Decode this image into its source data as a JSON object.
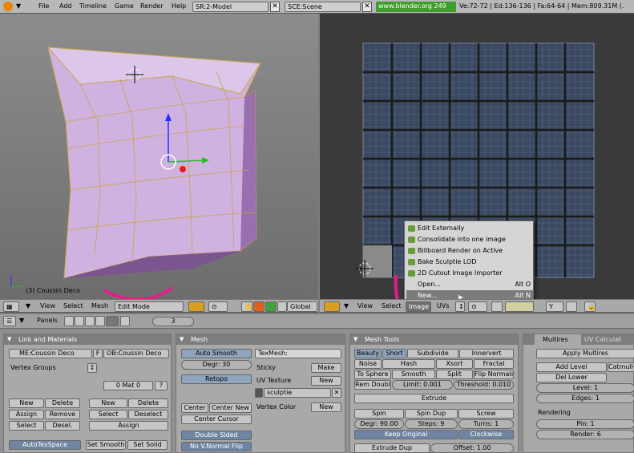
{
  "topbar": {
    "menu": [
      "File",
      "Add",
      "Timeline",
      "Game",
      "Render",
      "Help"
    ],
    "screen": "SR:2-Model",
    "scene": "SCE:Scene",
    "link": "www.blender.org 249",
    "stats": "Ve:72-72 | Ed:136-136 | Fa:64-64 | Mem:809.31M (."
  },
  "viewport": {
    "object_label": "(3) Coussin Deco",
    "menus": [
      "View",
      "Select",
      "Mesh"
    ],
    "mode": "Edit Mode",
    "orientation": "Global"
  },
  "uv_editor": {
    "menus": [
      "View",
      "Select",
      "Image",
      "UVs"
    ],
    "context_menu": {
      "items": [
        {
          "label": "Edit Externally",
          "shortcut": ""
        },
        {
          "label": "Consolidate into one image",
          "shortcut": ""
        },
        {
          "label": "Billboard Render on Active",
          "shortcut": ""
        },
        {
          "label": "Bake Sculptie LOD",
          "shortcut": ""
        },
        {
          "label": "2D Cutout Image Importer",
          "shortcut": ""
        },
        {
          "label": "Open...",
          "shortcut": "Alt O"
        },
        {
          "label": "New...",
          "shortcut": "Alt N"
        }
      ]
    }
  },
  "panels_bar": {
    "label": "Panels",
    "page": "3"
  },
  "link_materials": {
    "title": "Link and Materials",
    "mesh_name": "ME:Coussin Deco",
    "f_label": "F",
    "ob_name": "OB:Coussin Deco",
    "vertex_groups": "Vertex Groups",
    "mat": "0 Mat 0",
    "q": "?",
    "left_buttons": [
      "New",
      "Delete",
      "Assign",
      "Remove",
      "Select",
      "Desel."
    ],
    "right_buttons": [
      "New",
      "Delete",
      "Select",
      "Deselect",
      "Assign"
    ],
    "autotex": "AutoTexSpace",
    "set_smooth": "Set Smooth",
    "set_solid": "Set Solid"
  },
  "mesh": {
    "title": "Mesh",
    "auto_smooth": "Auto Smooth",
    "degr": "Degr: 30",
    "retopo": "Retopo",
    "center": "Center",
    "center_new": "Center New",
    "center_cursor": "Center Cursor",
    "double_sided": "Double Sided",
    "no_vnormal": "No V.Normal Flip",
    "texmesh": "TexMesh:",
    "sticky": "Sticky",
    "make": "Make",
    "uv_texture": "UV Texture",
    "new": "New",
    "uv_name": "sculptie",
    "vertex_color": "Vertex Color"
  },
  "mesh_tools": {
    "title": "Mesh Tools",
    "row1": [
      "Beauty",
      "Short",
      "Subdivide",
      "Innervert"
    ],
    "noise": "Noise",
    "hash": "Hash",
    "xsort": "Xsort",
    "fractal": "Fractal",
    "to_sphere": "To Sphere",
    "smooth": "Smooth",
    "split": "Split",
    "flip_normals": "Flip Normals",
    "rem_doubl": "Rem Doubl",
    "limit": "Limit: 0.001",
    "threshold": "Threshold: 0.010",
    "extrude": "Extrude",
    "spin": "Spin",
    "spin_dup": "Spin Dup",
    "screw": "Screw",
    "degr": "Degr: 90.00",
    "steps": "Steps: 9",
    "turns": "Turns: 1",
    "keep_original": "Keep Original",
    "clockwise": "Clockwise",
    "extrude_dup": "Extrude Dup",
    "offset": "Offset: 1.00"
  },
  "multires": {
    "tab1": "Multires",
    "tab2": "UV Calculat",
    "apply": "Apply Multires",
    "add_level": "Add Level",
    "catmull": "Catmull-",
    "del_lower": "Del Lower",
    "level": "Level: 1",
    "edges": "Edges: 1",
    "rendering": "Rendering",
    "pin": "Pin: 1",
    "render": "Render: 6"
  }
}
